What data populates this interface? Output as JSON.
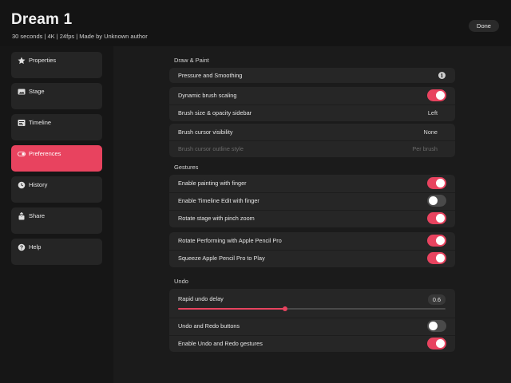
{
  "header": {
    "title": "Dream 1",
    "subtitle": "30 seconds  |  4K  |  24fps  |  Made by Unknown author",
    "done_label": "Done"
  },
  "sidebar": {
    "items": [
      {
        "label": "Properties",
        "icon": "star-icon"
      },
      {
        "label": "Stage",
        "icon": "image-icon"
      },
      {
        "label": "Timeline",
        "icon": "film-icon"
      },
      {
        "label": "Preferences",
        "icon": "toggle-icon",
        "active": true
      },
      {
        "label": "History",
        "icon": "clock-icon"
      },
      {
        "label": "Share",
        "icon": "share-icon"
      },
      {
        "label": "Help",
        "icon": "question-icon"
      }
    ]
  },
  "sections": {
    "draw_paint": {
      "title": "Draw & Paint",
      "pressure": "Pressure and Smoothing",
      "dynamic_brush": {
        "label": "Dynamic brush scaling",
        "on": true
      },
      "brush_sidebar": {
        "label": "Brush size & opacity sidebar",
        "value": "Left"
      },
      "cursor_visibility": {
        "label": "Brush cursor visibility",
        "value": "None"
      },
      "cursor_outline": {
        "label": "Brush cursor outline style",
        "value": "Per brush"
      }
    },
    "gestures": {
      "title": "Gestures",
      "painting_finger": {
        "label": "Enable painting with finger",
        "on": true
      },
      "timeline_edit": {
        "label": "Enable Timeline Edit with finger",
        "on": false
      },
      "rotate_stage": {
        "label": "Rotate stage with pinch zoom",
        "on": true
      },
      "rotate_performing": {
        "label": "Rotate Performing with Apple Pencil Pro",
        "on": true
      },
      "squeeze_play": {
        "label": "Squeeze Apple Pencil Pro to Play",
        "on": true
      }
    },
    "undo": {
      "title": "Undo",
      "rapid_delay": {
        "label": "Rapid undo delay",
        "value": "0.6",
        "fraction": 0.4
      },
      "undo_buttons": {
        "label": "Undo and Redo buttons",
        "on": false
      },
      "undo_gestures": {
        "label": "Enable Undo and Redo gestures",
        "on": true
      }
    }
  },
  "colors": {
    "accent": "#e8435f",
    "background": "#141414",
    "panel": "#262626"
  }
}
